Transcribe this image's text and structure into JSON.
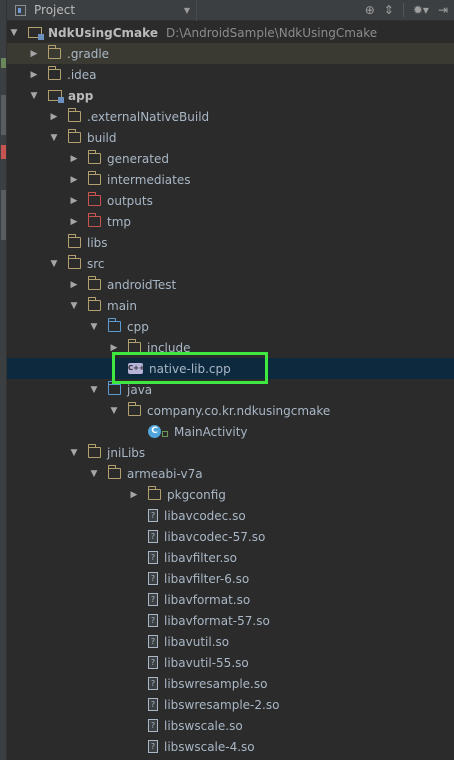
{
  "header": {
    "title": "Project",
    "icons": [
      "project-icon",
      "chevron-down-icon",
      "sync-target-icon",
      "collapse-all-icon",
      "gear-icon",
      "hide-icon"
    ]
  },
  "tree": [
    {
      "label": "NdkUsingCmake",
      "path": "D:\\AndroidSample\\NdkUsingCmake",
      "icon": "module-folder",
      "expanded": true,
      "bold": true
    },
    {
      "label": ".gradle",
      "icon": "folder",
      "expanded": false
    },
    {
      "label": ".idea",
      "icon": "folder",
      "expanded": false
    },
    {
      "label": "app",
      "icon": "module-folder",
      "expanded": true,
      "bold": true
    },
    {
      "label": ".externalNativeBuild",
      "icon": "folder",
      "expanded": false
    },
    {
      "label": "build",
      "icon": "folder",
      "expanded": true
    },
    {
      "label": "generated",
      "icon": "folder",
      "expanded": false
    },
    {
      "label": "intermediates",
      "icon": "folder",
      "expanded": false
    },
    {
      "label": "outputs",
      "icon": "folder-red",
      "expanded": false
    },
    {
      "label": "tmp",
      "icon": "folder-red",
      "expanded": false
    },
    {
      "label": "libs",
      "icon": "folder"
    },
    {
      "label": "src",
      "icon": "folder",
      "expanded": true
    },
    {
      "label": "androidTest",
      "icon": "folder",
      "expanded": false
    },
    {
      "label": "main",
      "icon": "folder",
      "expanded": true
    },
    {
      "label": "cpp",
      "icon": "folder-blue",
      "expanded": true
    },
    {
      "label": "include",
      "icon": "folder",
      "expanded": false
    },
    {
      "label": "native-lib.cpp",
      "icon": "cpp-file",
      "selected": true
    },
    {
      "label": "java",
      "icon": "folder-blue",
      "expanded": true
    },
    {
      "label": "company.co.kr.ndkusingcmake",
      "icon": "folder",
      "expanded": true
    },
    {
      "label": "MainActivity",
      "icon": "class",
      "badge": "C"
    },
    {
      "label": "jniLibs",
      "icon": "folder",
      "expanded": true
    },
    {
      "label": "armeabi-v7a",
      "icon": "folder",
      "expanded": true
    },
    {
      "label": "pkgconfig",
      "icon": "folder",
      "expanded": false
    },
    {
      "label": "libavcodec.so",
      "icon": "unknown-file"
    },
    {
      "label": "libavcodec-57.so",
      "icon": "unknown-file"
    },
    {
      "label": "libavfilter.so",
      "icon": "unknown-file"
    },
    {
      "label": "libavfilter-6.so",
      "icon": "unknown-file"
    },
    {
      "label": "libavformat.so",
      "icon": "unknown-file"
    },
    {
      "label": "libavformat-57.so",
      "icon": "unknown-file"
    },
    {
      "label": "libavutil.so",
      "icon": "unknown-file"
    },
    {
      "label": "libavutil-55.so",
      "icon": "unknown-file"
    },
    {
      "label": "libswresample.so",
      "icon": "unknown-file"
    },
    {
      "label": "libswresample-2.so",
      "icon": "unknown-file"
    },
    {
      "label": "libswscale.so",
      "icon": "unknown-file"
    },
    {
      "label": "libswscale-4.so",
      "icon": "unknown-file"
    }
  ],
  "colors": {
    "background": "#2b2b2b",
    "selection": "#0d293e",
    "excluded_row": "#3b3a32",
    "highlight_box": "#3fe83f",
    "folder": "#b3a06f",
    "source_folder": "#5c9ad4",
    "excluded_folder": "#c75450"
  }
}
